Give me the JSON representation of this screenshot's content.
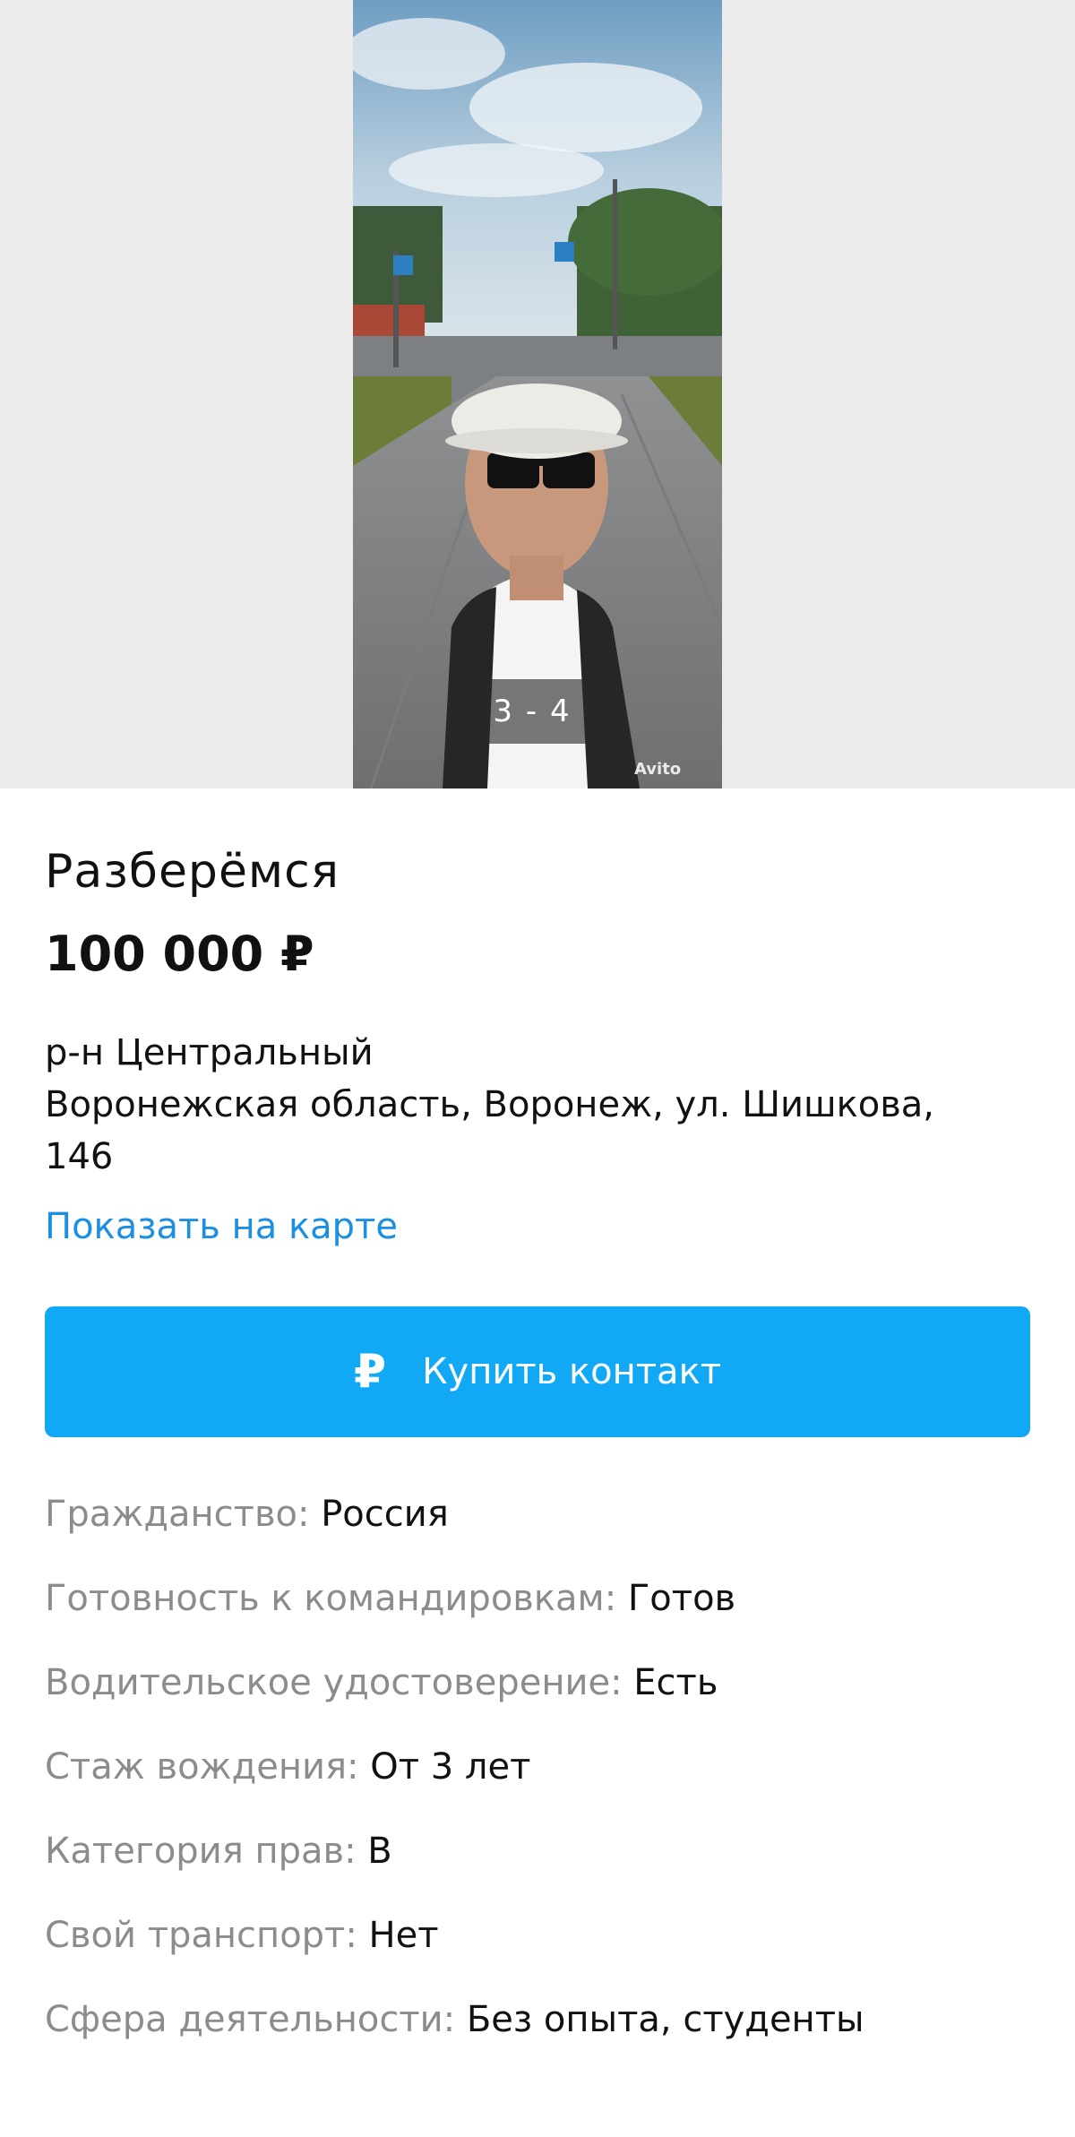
{
  "gallery": {
    "counter": "3 - 4",
    "watermark": "Avito"
  },
  "listing": {
    "title": "Разберёмся",
    "price": "100 000 ₽",
    "district": "р-н Центральный",
    "address_line1": "Воронежская область, Воронеж, ул. Шишкова,",
    "address_line2": "146",
    "map_link": "Показать на карте"
  },
  "buy_button": {
    "icon_glyph": "₽",
    "label": "Купить контакт",
    "color": "#11a9f5"
  },
  "params": [
    {
      "key": "Гражданство:",
      "value": "Россия"
    },
    {
      "key": "Готовность к командировкам:",
      "value": "Готов"
    },
    {
      "key": "Водительское удостоверение:",
      "value": "Есть"
    },
    {
      "key": "Стаж вождения:",
      "value": "От 3 лет"
    },
    {
      "key": "Категория прав:",
      "value": "B"
    },
    {
      "key": "Свой транспорт:",
      "value": "Нет"
    },
    {
      "key": "Сфера деятельности:",
      "value": "Без опыта, студенты"
    }
  ]
}
